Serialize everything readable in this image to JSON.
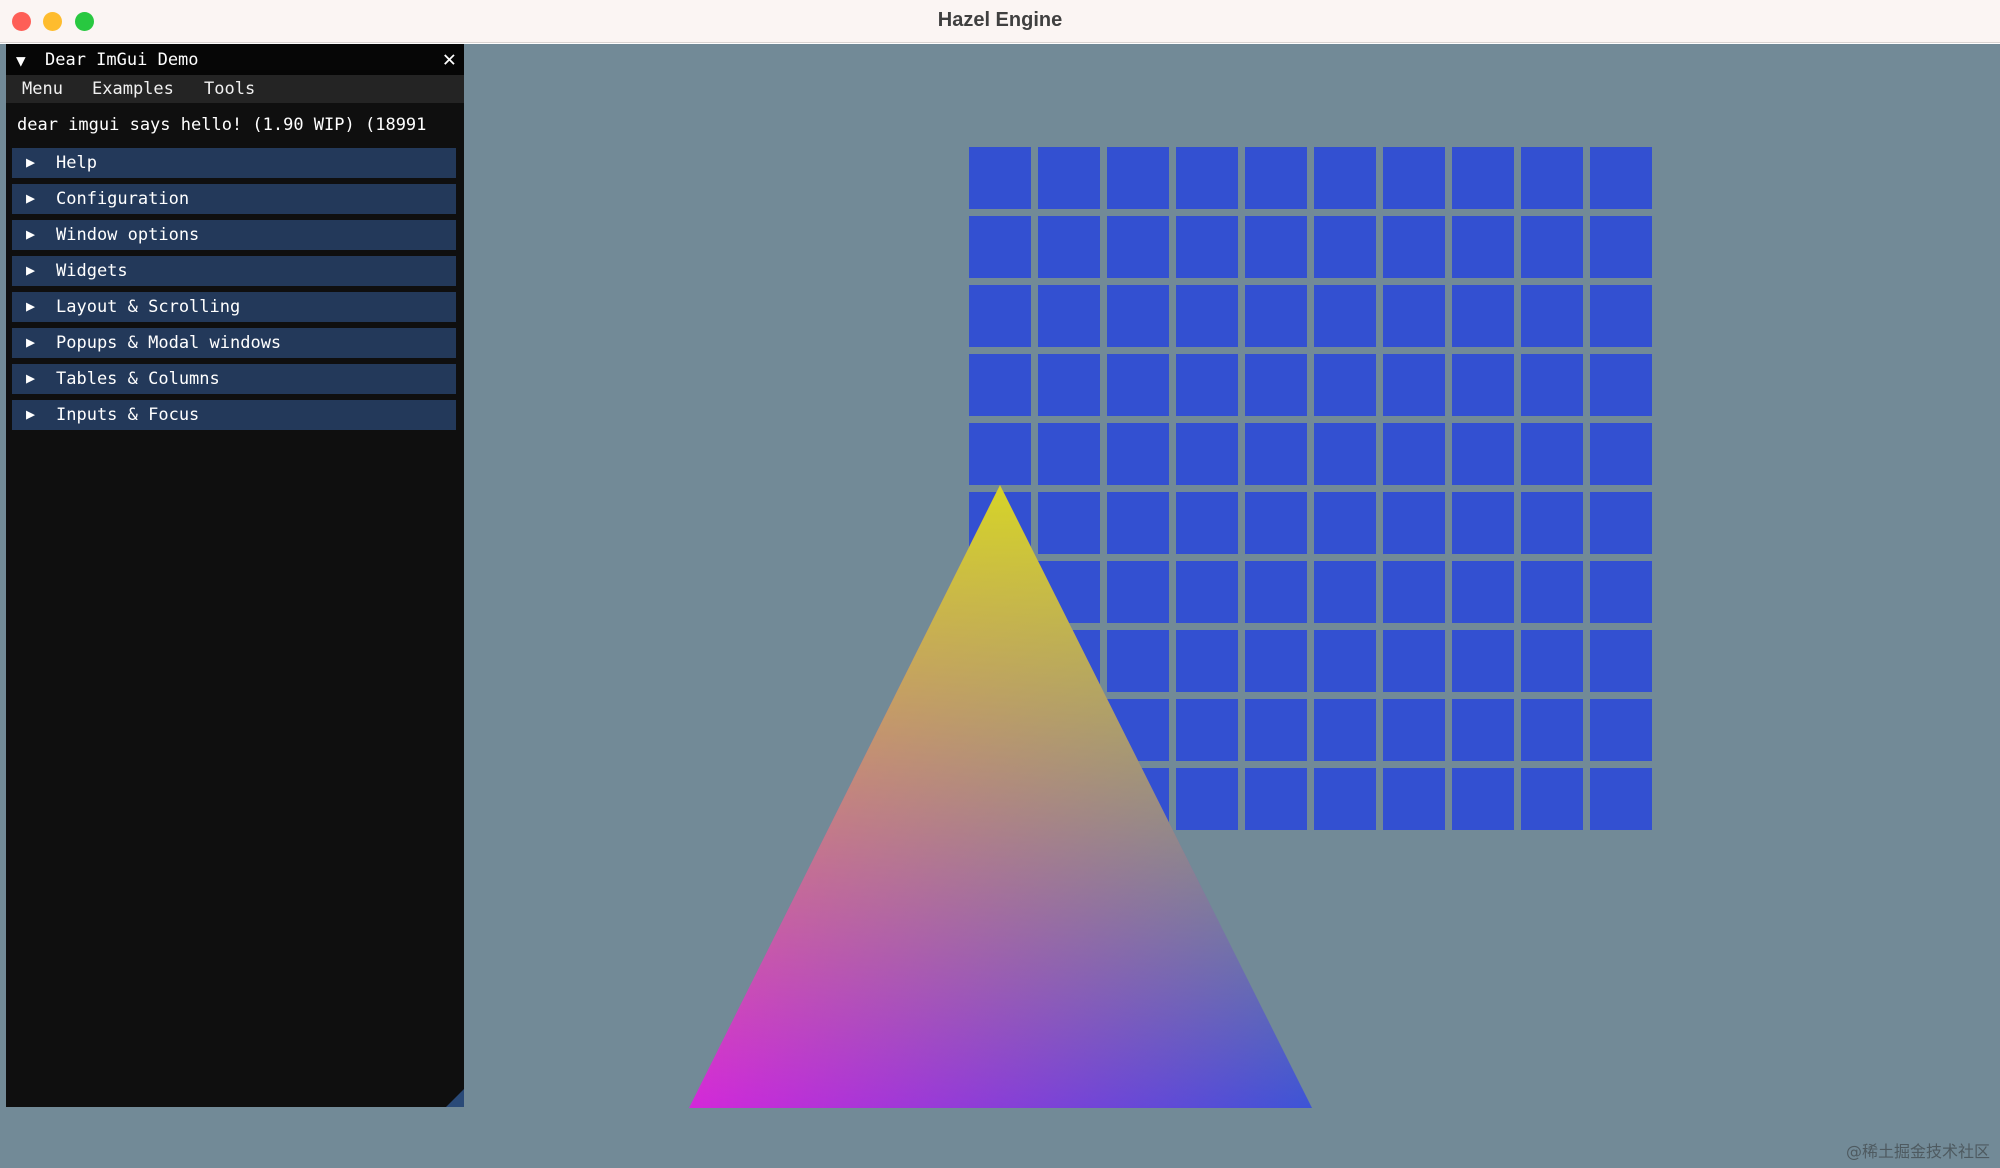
{
  "window": {
    "title": "Hazel Engine"
  },
  "colors": {
    "viewport_bg": "#728a97",
    "grid_quad": "#3350d1",
    "triangle_top": "#d6d428",
    "triangle_left": "#d428d9",
    "triangle_right": "#3d54d6",
    "header_bg": "#23395a"
  },
  "imgui": {
    "title": "Dear ImGui Demo",
    "collapse_icon": "▼",
    "close_icon": "✕",
    "menu": [
      "Menu",
      "Examples",
      "Tools"
    ],
    "hello": "dear imgui says hello! (1.90 WIP) (18991",
    "headers": [
      "Help",
      "Configuration",
      "Window options",
      "Widgets",
      "Layout & Scrolling",
      "Popups & Modal windows",
      "Tables & Columns",
      "Inputs & Focus"
    ]
  },
  "scene": {
    "grid_cols": 10,
    "grid_rows": 10
  },
  "watermark": "@稀土掘金技术社区"
}
